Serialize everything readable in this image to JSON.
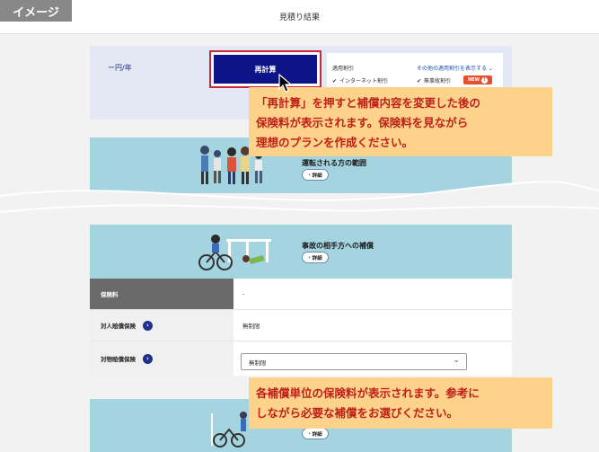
{
  "image_tag": "イメージ",
  "header": {
    "title": "見積り結果"
  },
  "premium": {
    "unit": "ー円/年",
    "recalc_label": "再計算"
  },
  "discounts": {
    "title": "適用割引",
    "show_other_link": "その他の適用割引を表示する",
    "items": [
      "インターネット割引",
      "無事故割引"
    ],
    "new_badge": "NEW",
    "new_badge_icon": "info-circle-icon"
  },
  "callouts": {
    "recalc_note_lines": [
      "「再計算」を押すと補償内容を変更した後の",
      "保険料が表示されます。保険料を見ながら",
      "理想のプランを作成ください。"
    ],
    "unit_note_lines": [
      "各補償単位の保険料が表示されます。参考に",
      "しながら必要な補償をお選びください。"
    ]
  },
  "cards": {
    "drivers": {
      "title": "運転される方の範囲",
      "detail": "詳細"
    },
    "third_party": {
      "title": "事故の相手方への補償",
      "detail": "詳細"
    },
    "bottom": {
      "detail": "詳細"
    }
  },
  "table": {
    "premium_row": {
      "label": "保険料",
      "value": "-"
    },
    "bodily_row": {
      "label": "対人賠償保険",
      "value": "無制限"
    },
    "property_row": {
      "label": "対物賠償保険",
      "value": "無制限"
    }
  },
  "colors": {
    "brand_navy": "#0c1488",
    "highlight_red": "#c8283c",
    "callout_bg": "#fdd28a",
    "banner_blue": "#a3d4e0"
  }
}
